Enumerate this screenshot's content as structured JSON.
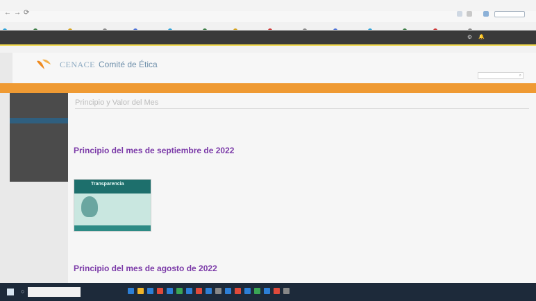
{
  "browser": {
    "nav_back": "←",
    "nav_forward": "→",
    "nav_reload": "⟳",
    "address_text": "",
    "bookmarks": [
      {
        "color": "#2aa0d8"
      },
      {
        "color": "#3a7d44"
      },
      {
        "color": "#d4a018"
      },
      {
        "color": "#888888"
      },
      {
        "color": "#4a6fd6"
      },
      {
        "color": "#2aa0d8"
      },
      {
        "color": "#3a7d44"
      },
      {
        "color": "#d4a018"
      },
      {
        "color": "#cc3333"
      },
      {
        "color": "#888888"
      },
      {
        "color": "#4a6fd6"
      },
      {
        "color": "#2aa0d8"
      },
      {
        "color": "#3a7d44"
      },
      {
        "color": "#cc3333"
      },
      {
        "color": "#888888"
      }
    ]
  },
  "site_top": {
    "gear": "⚙",
    "bell": "🔔",
    "user_name": ""
  },
  "crumb": {
    "text": ""
  },
  "header": {
    "brand": "CENACE",
    "title": "Comité de Ética",
    "tagline": "",
    "util_links": "",
    "search_placeholder": "",
    "search_icon": "⌕"
  },
  "orange_nav": {
    "links": ""
  },
  "sidebar": {
    "items": [
      {
        "label": "",
        "active": false
      },
      {
        "label": "",
        "active": false
      },
      {
        "label": "",
        "active": false
      },
      {
        "label": "",
        "active": true
      },
      {
        "label": "",
        "active": false
      },
      {
        "label": "",
        "active": false
      },
      {
        "label": "",
        "active": false
      },
      {
        "label": "",
        "active": false
      },
      {
        "label": "",
        "active": false
      },
      {
        "label": "",
        "active": false
      }
    ]
  },
  "content": {
    "page_title": "Principio y Valor del Mes",
    "intro_lines": [
      "",
      "",
      ""
    ],
    "heading_sept": "Principio del mes de septiembre de 2022",
    "sept_lines": [
      "",
      "",
      ""
    ],
    "thumb_title": "Transparencia",
    "thumb_text": "",
    "thumb_caption": "",
    "links": "",
    "heading_aug": "Principio del mes de agosto de 2022",
    "aug_line": ""
  },
  "taskbar": {
    "search_text": "",
    "apps": [
      "#2d7fd6",
      "#f0b429",
      "#2d7fd6",
      "#e04a3a",
      "#2d7fd6",
      "#3aa655",
      "#2d7fd6",
      "#e04a3a",
      "#2d7fd6",
      "#888888",
      "#2d7fd6",
      "#e04a3a",
      "#2d7fd6",
      "#3aa655",
      "#2d7fd6",
      "#e04a3a",
      "#888888"
    ],
    "tray": ""
  }
}
